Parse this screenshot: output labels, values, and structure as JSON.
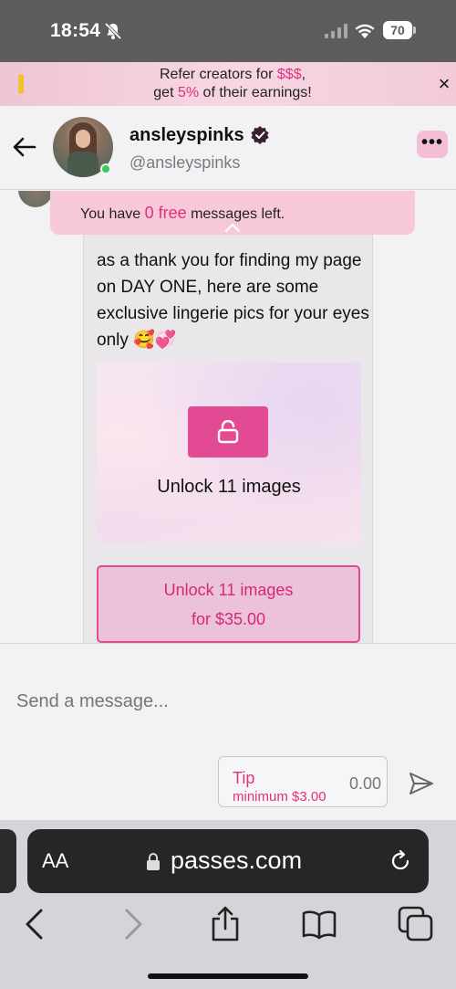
{
  "status_bar": {
    "time": "18:54",
    "battery": "70"
  },
  "promo": {
    "line1_prefix": "Refer creators for ",
    "line1_highlight": "$$$",
    "line1_suffix": ",",
    "line2_prefix": "get ",
    "line2_highlight": "5%",
    "line2_suffix": " of their earnings!",
    "close": "×"
  },
  "header": {
    "name": "ansleyspinks",
    "handle": "@ansleyspinks",
    "more": "•••"
  },
  "free_messages": {
    "prefix": "You have ",
    "count": "0 free",
    "suffix": " messages left."
  },
  "message": {
    "text": "as a thank you for finding my page on DAY ONE, here are some exclusive lingerie pics for your eyes only 🥰💞",
    "locked_label": "Unlock 11 images",
    "unlock_line1": "Unlock 11 images",
    "unlock_line2": "for $35.00"
  },
  "composer": {
    "placeholder": "Send a message...",
    "tip_label": "Tip",
    "tip_minimum": "minimum $3.00",
    "tip_amount": "0.00"
  },
  "browser": {
    "text_size": "AA",
    "domain": "passes.com"
  },
  "colors": {
    "accent": "#e24a94",
    "accent_text": "#e0317f",
    "online": "#37c95a"
  }
}
